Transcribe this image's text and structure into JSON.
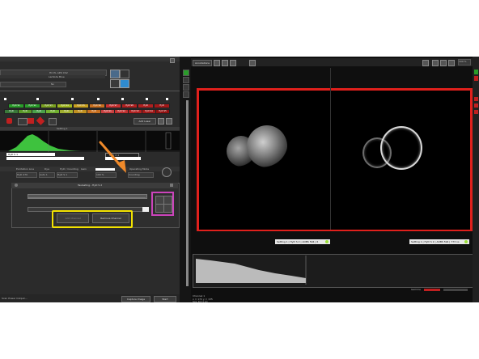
{
  "left": {
    "top_lines": [
      "HC PL APO CS2",
      "Lambda Blue",
      "No",
      "Acquire"
    ],
    "channel_tabs": [
      "HyD",
      "HyD",
      "HyD",
      "HyD",
      "HyD",
      "HyD",
      "HyD",
      "HyD",
      "HyD"
    ],
    "channel_buttons": [
      "HyD S1",
      "HyD S2",
      "HyD S3",
      "HyD S4",
      "HyD S5",
      "HyD S6",
      "HyD S7",
      "HyD S8"
    ],
    "add_laser": "Add Laser",
    "setting_label": "Setting 1",
    "hyd_left": "HyD S 1",
    "hyd_right": "HyD X 4",
    "detector_row": [
      "Excitation Line",
      "Dye",
      "HyD / Counting",
      "Gain",
      "Operating Mode"
    ],
    "detector_values": [
      "HyD 470",
      "Auto 1",
      "HyD S 1",
      "100 %",
      "Counting"
    ],
    "dialog_title": "TauGating - HyD S 2",
    "add_channel": "Add Channel",
    "remove_channel": "Remove Channel",
    "status_text": "Scan Power Output...",
    "capture_image": "Capture Image",
    "start": "Start"
  },
  "viewer": {
    "tab_label": "Annotations",
    "zoom": "100 %",
    "legend_left": "Setting 1 | HyD S 2 | AOBS 594 | 6",
    "legend_right": "Setting 1 | HyD S 2 | AOBS 594 | 773 ns",
    "lut_label": "Gamma",
    "status_lines": [
      "Channel 1",
      "x = 172 y = 135",
      "Size: 46.71 µm"
    ]
  },
  "colors": {
    "highlight_red": "#e0201c",
    "highlight_yellow": "#f2e200",
    "highlight_magenta": "#cc44bb",
    "arrow_orange": "#f08a2a"
  }
}
